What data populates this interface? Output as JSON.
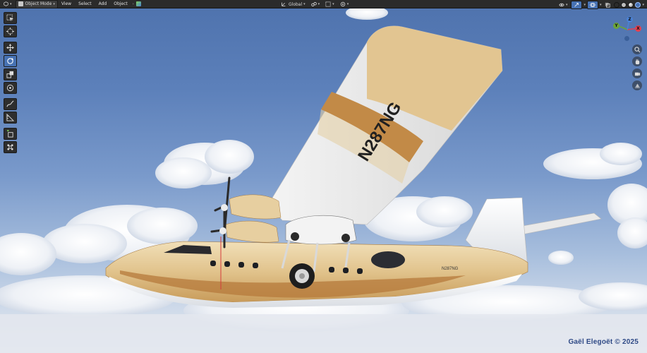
{
  "header": {
    "editor_type_icon": "3d-viewport-icon",
    "mode_label": "Object Mode",
    "menus": [
      "View",
      "Select",
      "Add",
      "Object"
    ],
    "transform_orientation": "Global"
  },
  "toolbar": {
    "tools": [
      {
        "name": "select-box-tool",
        "icon": "select-box-icon",
        "active": false
      },
      {
        "name": "cursor-tool",
        "icon": "cursor-icon",
        "active": false
      },
      {
        "name": "move-tool",
        "icon": "move-icon",
        "active": false
      },
      {
        "name": "rotate-tool",
        "icon": "rotate-icon",
        "active": true
      },
      {
        "name": "scale-tool",
        "icon": "scale-icon",
        "active": false
      },
      {
        "name": "transform-tool",
        "icon": "transform-icon",
        "active": false
      },
      {
        "name": "annotate-tool",
        "icon": "annotate-icon",
        "active": false
      },
      {
        "name": "measure-tool",
        "icon": "measure-icon",
        "active": false
      },
      {
        "name": "add-cube-tool",
        "icon": "add-cube-icon",
        "active": false
      },
      {
        "name": "add-object-tool",
        "icon": "add-object-icon",
        "active": false
      }
    ]
  },
  "gizmo": {
    "axes": [
      "Y",
      "X",
      "Z"
    ],
    "colors": {
      "x": "#e5404f",
      "y": "#6ba539",
      "z": "#4a82d6"
    }
  },
  "scene": {
    "registration_wing": "N287NG",
    "registration_fuselage": "N287NG"
  },
  "credit": "Gaël Elegoët © 2025",
  "colors": {
    "accent": "#4772b3",
    "sky_top": "#4e72ad",
    "livery_gold": "#e2c591",
    "livery_brown": "#b57a3b"
  }
}
